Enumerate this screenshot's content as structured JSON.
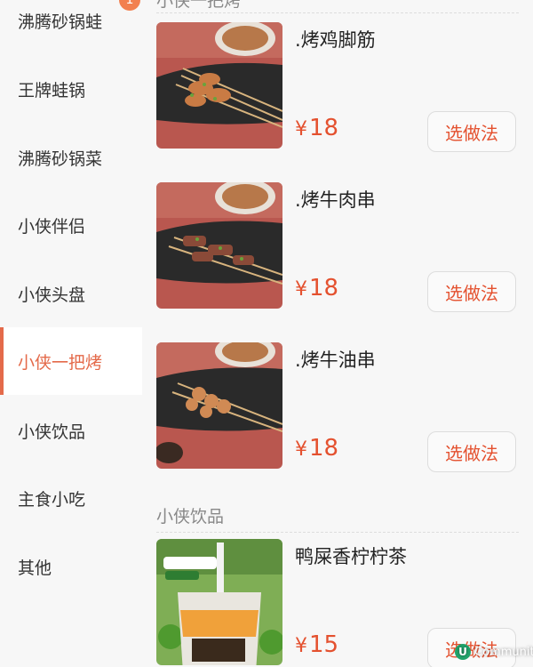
{
  "sidebar": {
    "badge": "1",
    "items": [
      {
        "label": "沸腾砂锅蛙"
      },
      {
        "label": "王牌蛙锅"
      },
      {
        "label": "沸腾砂锅菜"
      },
      {
        "label": "小侠伴侣"
      },
      {
        "label": "小侠头盘"
      },
      {
        "label": "小侠一把烤"
      },
      {
        "label": "小侠饮品"
      },
      {
        "label": "主食小吃"
      },
      {
        "label": "其他"
      }
    ],
    "active_index": 5
  },
  "sections": [
    {
      "title": "小侠一把烤"
    },
    {
      "title": "小侠饮品"
    }
  ],
  "products": [
    {
      "name": ".烤鸡脚筋",
      "currency": "¥",
      "price": "18",
      "button": "选做法",
      "image": "grilled-skewers"
    },
    {
      "name": ".烤牛肉串",
      "currency": "¥",
      "price": "18",
      "button": "选做法",
      "image": "grilled-skewers"
    },
    {
      "name": ".烤牛油串",
      "currency": "¥",
      "price": "18",
      "button": "选做法",
      "image": "grilled-skewers"
    },
    {
      "name": "鸭屎香柠柠茶",
      "currency": "¥",
      "price": "15",
      "button": "选做法",
      "image": "lemon-tea-cup"
    }
  ],
  "colors": {
    "accent": "#e46a4a",
    "price": "#e4512f",
    "badge": "#f2804f"
  },
  "watermark": {
    "logo": "U",
    "text": "Community"
  }
}
